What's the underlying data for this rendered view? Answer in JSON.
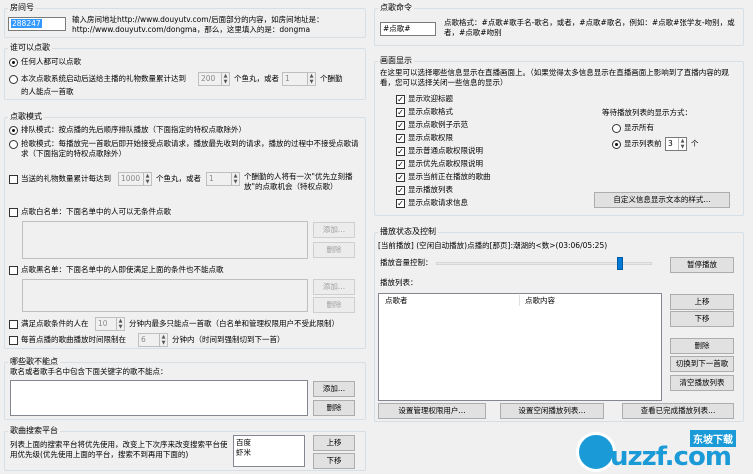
{
  "room": {
    "title": "房间号",
    "value": "288247",
    "hint": "输入房间地址http://www.douyutv.com/后面部分的内容，如房间地址是：http://www.douyutv.com/dongma，那么，这里填入的是：dongma"
  },
  "who": {
    "title": "谁可以点歌",
    "opt1": "任何人都可以点歌",
    "opt2": "本次点歌系统启动后送给主播的礼物数量累计达到",
    "fish": "200",
    "unit1": "个鱼丸，或者",
    "count": "1",
    "unit2": "个酬勤",
    "tail": "的人能点一首歌"
  },
  "mode": {
    "title": "点歌模式",
    "opt1": "排队模式：按点播的先后顺序排队播放（下面指定的特权点歌除外）",
    "opt2": "抢歌模式：每播放完一首歌后即开始接受点歌请求，播放最先收到的请求，播放的过程中不接受点歌请求（下面指定的特权点歌除外）",
    "priority": "当送的礼物数量累计每达到",
    "pfish": "1000",
    "punit1": "个鱼丸，或者",
    "pcount": "1",
    "punit2": "个酬勤的人将有一次\"优先立刻播放\"的点歌机会（特权点歌）",
    "whitelist": "点歌白名单：下面名单中的人可以无条件点歌",
    "blacklist": "点歌黑名单：下面名单中的人即使满足上面的条件也不能点歌",
    "add": "添加...",
    "del": "删除",
    "full_pre": "满足点歌条件的人在",
    "full_val": "10",
    "full_post": "分钟内最多只能点一首歌（白名单和管理权限用户不受此限制）",
    "limit_pre": "每首点播的歌曲播放时间限制在",
    "limit_val": "6",
    "limit_post": "分钟内（时间到强制切到下一首）"
  },
  "banned": {
    "title": "哪些歌不能点",
    "desc": "歌名或者歌手名中包含下面关键字的歌不能点：",
    "add": "添加...",
    "del": "删除"
  },
  "platform": {
    "title": "歌曲搜索平台",
    "desc": "列表上面的搜索平台将优先使用，改变上下次序来改变搜索平台使用优先级(优先使用上面的平台，搜索不到再用下面的)",
    "items": [
      "百度",
      "虾米"
    ],
    "up": "上移",
    "down": "下移"
  },
  "cmd": {
    "title": "点歌命令",
    "value": "#点歌#",
    "desc": "点歌格式：#点歌#歌手名-歌名，或者，#点歌#歌名，例如：#点歌#张学友-吻别，或者，#点歌#吻别"
  },
  "display": {
    "title": "画面显示",
    "desc": "在这里可以选择哪些信息显示在直播画面上。（如果觉得太多信息显示在直播画面上影响到了直播内容的观看，您可以选择关闭一些信息的显示）",
    "items": [
      "显示欢迎标题",
      "显示点歌格式",
      "显示点歌例子示范",
      "显示点歌权限",
      "显示普通点歌权限说明",
      "显示优先点歌权限说明",
      "显示当前正在播放的歌曲",
      "显示播放列表",
      "显示点歌请求信息"
    ],
    "mode_label": "等待播放列表的显示方式：",
    "all": "显示所有",
    "first": "显示列表前",
    "first_val": "3",
    "unit": "个",
    "custom": "自定义信息显示文本的样式..."
  },
  "play": {
    "title": "播放状态及控制",
    "now": "[当前播放] (空闲自动播放)点播的[那页]:潮湖的<数>(03:06/05:25)",
    "volume": "播放音量控制：",
    "volume_level": 0.85,
    "pause": "暂停播放",
    "list": "播放列表：",
    "col1": "点歌者",
    "col2": "点歌内容",
    "up": "上移",
    "down": "下移",
    "del": "删除",
    "next": "切换到下一首歌",
    "clear": "清空播放列表",
    "admin": "设置管理权限用户...",
    "idle": "设置空闲播放列表...",
    "done": "查看已完成播放列表..."
  },
  "watermark": {
    "brand1": "东坡下载",
    "brand2": "uzzf.com",
    "accent": "#1a9ad6"
  }
}
